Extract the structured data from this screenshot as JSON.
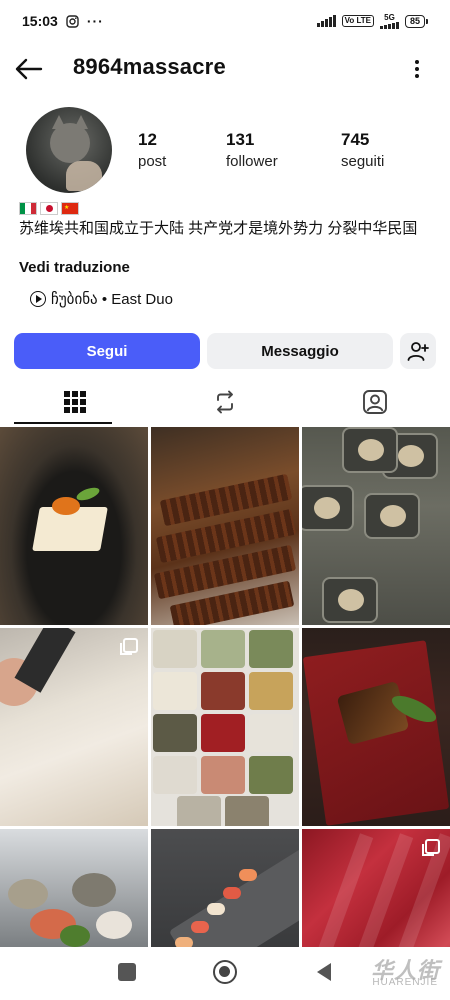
{
  "status_bar": {
    "time": "15:03",
    "network_chip": "Vo LTE",
    "network_type": "5G",
    "battery": "85",
    "icons": [
      "instagram-icon",
      "more-dots-icon",
      "signal-icon",
      "volte-icon",
      "5g-signal-icon",
      "battery-icon"
    ]
  },
  "header": {
    "username": "8964massacre",
    "back_icon": "arrow-left-icon",
    "menu_icon": "vertical-dots-icon"
  },
  "profile": {
    "stats": [
      {
        "value": "12",
        "label": "post"
      },
      {
        "value": "131",
        "label": "follower"
      },
      {
        "value": "745",
        "label": "seguiti"
      }
    ],
    "flags": [
      "flag-italy",
      "flag-japan",
      "flag-china"
    ],
    "bio": "苏维埃共和国成立于大陆 共产党才是境外势力 分裂中华民国",
    "translate_label": "Vedi traduzione",
    "music": "ჩუბინა • East Duo"
  },
  "actions": {
    "follow_label": "Segui",
    "message_label": "Messaggio",
    "add_user_icon": "person-add-icon",
    "follow_color": "#4a5df9"
  },
  "tabs": [
    {
      "name": "posts-grid",
      "icon": "grid-icon",
      "active": true
    },
    {
      "name": "reels",
      "icon": "repost-icon",
      "active": false
    },
    {
      "name": "tagged",
      "icon": "tagged-person-icon",
      "active": false
    }
  ],
  "grid": {
    "posts": [
      {
        "subject": "tofu with salmon roe in black bowl"
      },
      {
        "subject": "grilled eel fillets"
      },
      {
        "subject": "abalone dishes on slate plates"
      },
      {
        "subject": "knife and paper",
        "multiple": true
      },
      {
        "subject": "collage of plated dishes"
      },
      {
        "subject": "glazed fish on red tray"
      },
      {
        "subject": "oysters and sashimi platter"
      },
      {
        "subject": "nigiri sushi on slate"
      },
      {
        "subject": "sliced tuna",
        "multiple": true
      }
    ]
  },
  "nav_bar": {
    "watermark": "华人街",
    "watermark_sub": "HUARENJIE"
  }
}
